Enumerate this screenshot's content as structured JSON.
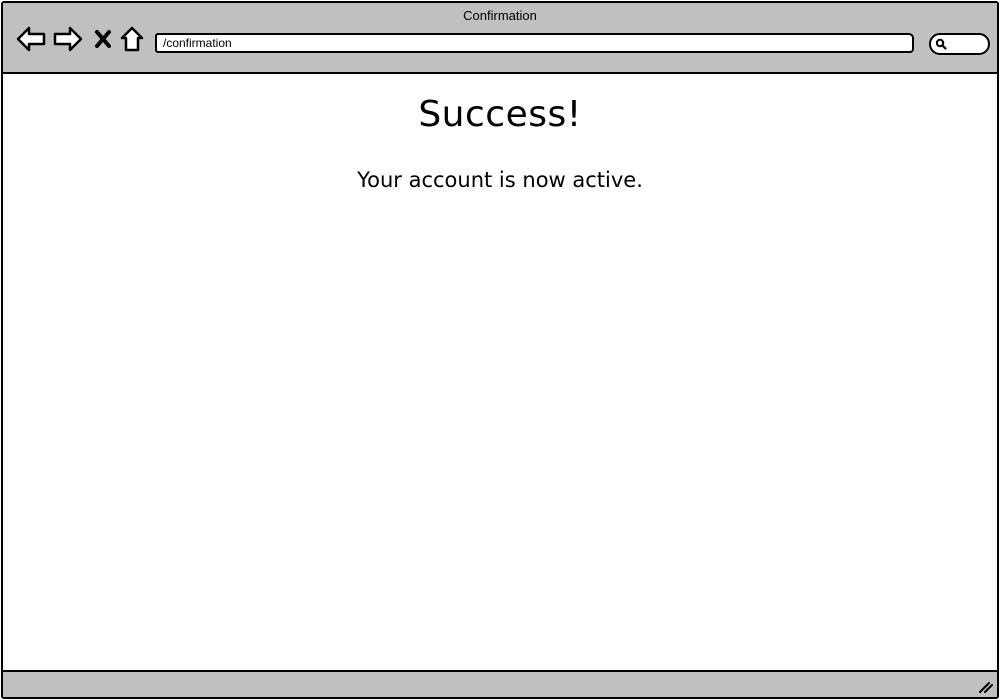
{
  "window": {
    "title": "Confirmation"
  },
  "toolbar": {
    "back_icon": "back-arrow-icon",
    "forward_icon": "forward-arrow-icon",
    "stop_icon": "close-x-icon",
    "home_icon": "home-icon",
    "address_value": "/confirmation",
    "search_icon": "search-icon"
  },
  "page": {
    "heading": "Success!",
    "message": "Your account is now active."
  },
  "statusbar": {
    "resize_icon": "resize-grip-icon"
  },
  "colors": {
    "chrome": "#c0c0c0",
    "background": "#ffffff",
    "stroke": "#000000"
  }
}
